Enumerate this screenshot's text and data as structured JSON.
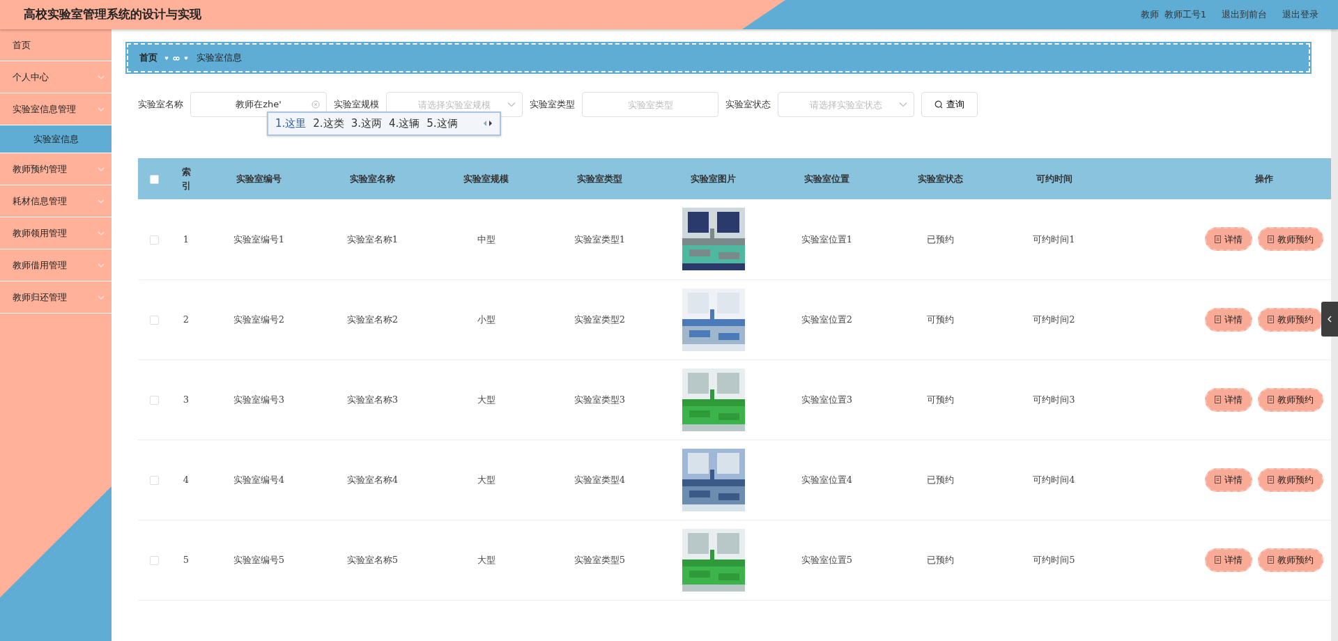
{
  "header": {
    "title": "高校实验室管理系统的设计与实现",
    "user_role": "教师",
    "user_name": "教师工号1",
    "links": [
      "退出到前台",
      "退出登录"
    ]
  },
  "sidebar": {
    "items": [
      {
        "label": "首页",
        "expandable": false
      },
      {
        "label": "个人中心",
        "expandable": true,
        "expanded": false
      },
      {
        "label": "实验室信息管理",
        "expandable": true,
        "expanded": true,
        "children": [
          {
            "label": "实验室信息",
            "selected": true
          }
        ]
      },
      {
        "label": "教师预约管理",
        "expandable": true,
        "expanded": false
      },
      {
        "label": "耗材信息管理",
        "expandable": true,
        "expanded": false
      },
      {
        "label": "教师领用管理",
        "expandable": true,
        "expanded": false
      },
      {
        "label": "教师借用管理",
        "expandable": true,
        "expanded": false
      },
      {
        "label": "教师归还管理",
        "expandable": true,
        "expanded": false
      }
    ]
  },
  "breadcrumb": {
    "items": [
      "首页",
      "实验室信息"
    ]
  },
  "search": {
    "fields": [
      {
        "kind": "text",
        "label": "实验室名称",
        "value": "教师在zhe'"
      },
      {
        "kind": "select",
        "label": "实验室规模",
        "placeholder": "请选择实验室规模"
      },
      {
        "kind": "text",
        "label": "实验室类型",
        "placeholder": "实验室类型"
      },
      {
        "kind": "select",
        "label": "实验室状态",
        "placeholder": "请选择实验室状态"
      }
    ],
    "button": "查询"
  },
  "ime_popup": {
    "candidates": [
      {
        "label": "1.这里",
        "selected": true
      },
      {
        "label": "2.这类",
        "selected": false
      },
      {
        "label": "3.这两",
        "selected": false
      },
      {
        "label": "4.这辆",
        "selected": false
      },
      {
        "label": "5.这俩",
        "selected": false
      }
    ]
  },
  "table": {
    "all_checked": false,
    "columns": [
      "索引",
      "实验室编号",
      "实验室名称",
      "实验室规模",
      "实验室类型",
      "实验室图片",
      "实验室位置",
      "实验室状态",
      "可约时间",
      "操作"
    ],
    "rows": [
      {
        "checked": false,
        "index": "1",
        "number": "实验室编号1",
        "name": "实验室名称1",
        "scale": "中型",
        "type": "实验室类型1",
        "location": "实验室位置1",
        "status": "已预约",
        "time": "可约时间1",
        "actions": [
          "详情",
          "教师预约"
        ]
      },
      {
        "checked": false,
        "index": "2",
        "number": "实验室编号2",
        "name": "实验室名称2",
        "scale": "小型",
        "type": "实验室类型2",
        "location": "实验室位置2",
        "status": "可预约",
        "time": "可约时间2",
        "actions": [
          "详情",
          "教师预约"
        ]
      },
      {
        "checked": false,
        "index": "3",
        "number": "实验室编号3",
        "name": "实验室名称3",
        "scale": "大型",
        "type": "实验室类型3",
        "location": "实验室位置3",
        "status": "可预约",
        "time": "可约时间3",
        "actions": [
          "详情",
          "教师预约"
        ]
      },
      {
        "checked": false,
        "index": "4",
        "number": "实验室编号4",
        "name": "实验室名称4",
        "scale": "大型",
        "type": "实验室类型4",
        "location": "实验室位置4",
        "status": "已预约",
        "time": "可约时间4",
        "actions": [
          "详情",
          "教师预约"
        ]
      },
      {
        "checked": false,
        "index": "5",
        "number": "实验室编号5",
        "name": "实验室名称5",
        "scale": "大型",
        "type": "实验室类型5",
        "location": "实验室位置5",
        "status": "已预约",
        "time": "可约时间5",
        "actions": [
          "详情",
          "教师预约"
        ]
      }
    ]
  }
}
